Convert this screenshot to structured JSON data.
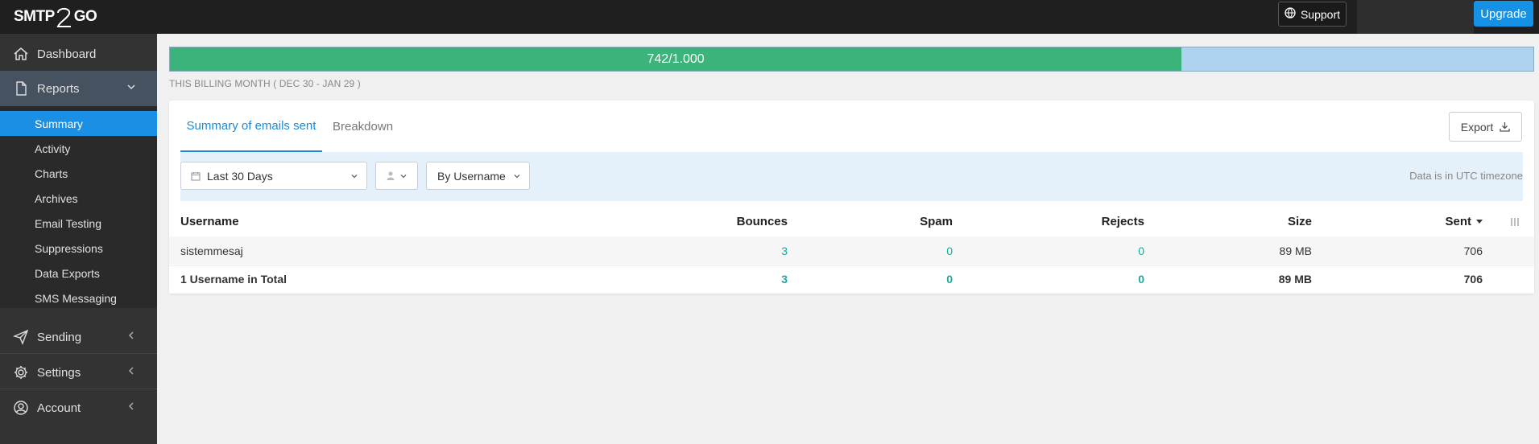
{
  "topbar": {
    "logo_text": "SMTP",
    "logo_suffix": "GO",
    "support_label": "Support",
    "upgrade_label": "Upgrade"
  },
  "sidebar": {
    "items": [
      {
        "label": "Dashboard",
        "icon": "home-icon"
      },
      {
        "label": "Reports",
        "icon": "document-icon"
      },
      {
        "label": "Sending",
        "icon": "paper-plane-icon"
      },
      {
        "label": "Settings",
        "icon": "gear-icon"
      },
      {
        "label": "Account",
        "icon": "user-circle-icon"
      }
    ],
    "sub_items": [
      "Summary",
      "Activity",
      "Charts",
      "Archives",
      "Email Testing",
      "Suppressions",
      "Data Exports",
      "SMS Messaging"
    ]
  },
  "usage": {
    "label": "742/1.000",
    "fraction": 0.742,
    "billing_text": "THIS BILLING MONTH ( DEC 30 - JAN 29 )"
  },
  "tabs": [
    "Summary of emails sent",
    "Breakdown"
  ],
  "export_label": "Export",
  "filters": {
    "date_range": "Last 30 Days",
    "group_by": "By Username",
    "timezone_note": "Data is in UTC timezone"
  },
  "table": {
    "headers": [
      "Username",
      "Bounces",
      "Spam",
      "Rejects",
      "Size",
      "Sent"
    ],
    "rows": [
      {
        "username": "sistemmesaj",
        "bounces": "3",
        "spam": "0",
        "rejects": "0",
        "size": "89 MB",
        "sent": "706"
      }
    ],
    "total": {
      "username": "1 Username in Total",
      "bounces": "3",
      "spam": "0",
      "rejects": "0",
      "size": "89 MB",
      "sent": "706"
    }
  },
  "colors": {
    "accent": "#1a8fe3",
    "progress": "#3bb37b",
    "teal": "#1aa99a"
  }
}
